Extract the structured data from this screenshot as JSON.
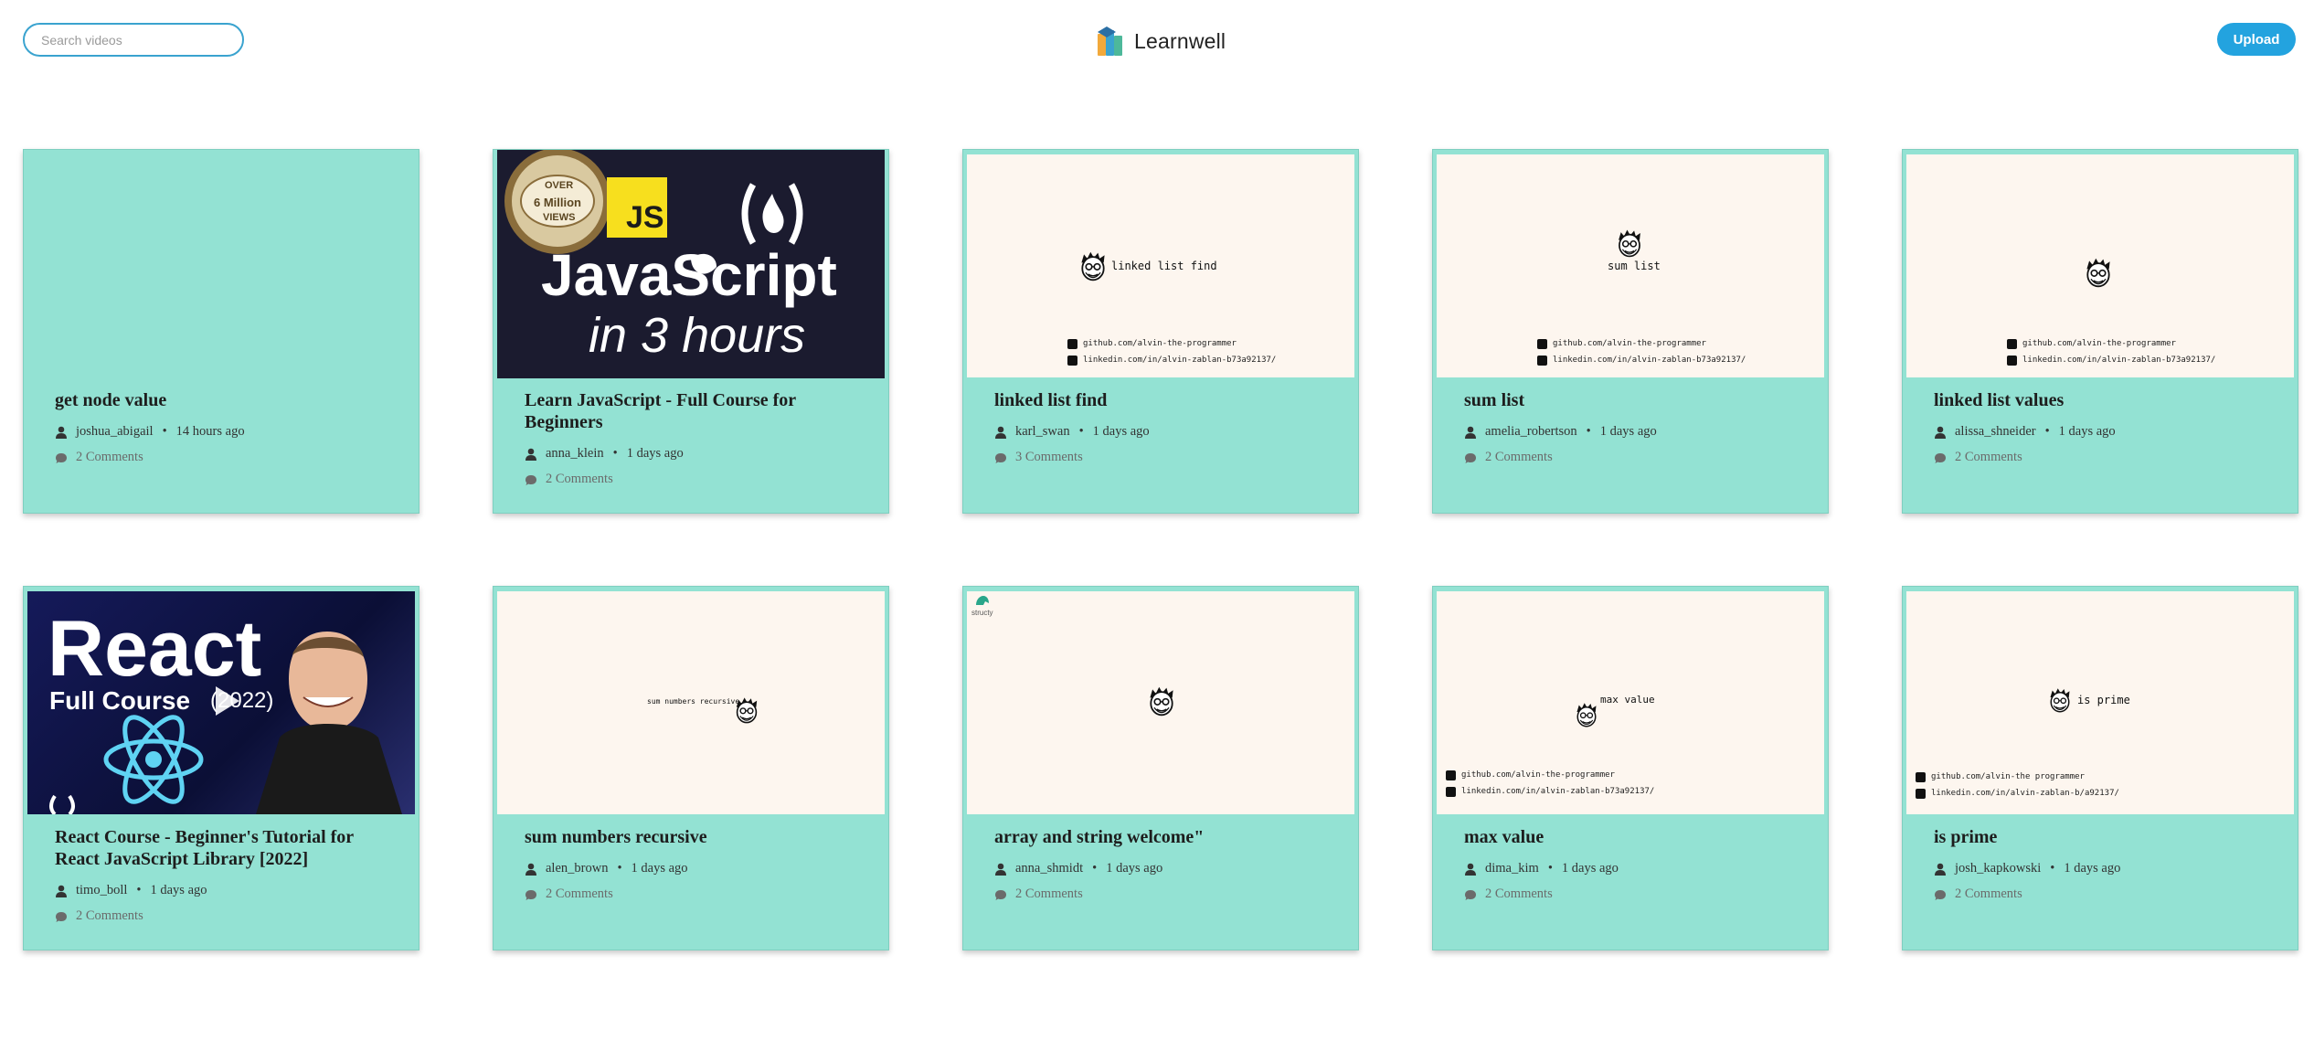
{
  "header": {
    "search_placeholder": "Search videos",
    "brand_name": "Learnwell",
    "upload_label": "Upload"
  },
  "videos": [
    {
      "title": "get node value",
      "author": "joshua_abigail",
      "time": "14 hours ago",
      "comments": "2 Comments"
    },
    {
      "title": "Learn JavaScript - Full Course for Beginners",
      "author": "anna_klein",
      "time": "1 days ago",
      "comments": "2 Comments",
      "thumb": {
        "badge_top": "OVER",
        "badge_mid": "6 Million",
        "badge_bot": "VIEWS",
        "js": "JS",
        "line1": "JavaScript",
        "line2": "in 3 hours"
      }
    },
    {
      "title": "linked list find",
      "author": "karl_swan",
      "time": "1 days ago",
      "comments": "3 Comments",
      "thumb": {
        "label": "linked list find",
        "link1": "github.com/alvin-the-programmer",
        "link2": "linkedin.com/in/alvin-zablan-b73a92137/"
      }
    },
    {
      "title": "sum list",
      "author": "amelia_robertson",
      "time": "1 days ago",
      "comments": "2 Comments",
      "thumb": {
        "label": "sum list",
        "link1": "github.com/alvin-the-programmer",
        "link2": "linkedin.com/in/alvin-zablan-b73a92137/"
      }
    },
    {
      "title": "linked list values",
      "author": "alissa_shneider",
      "time": "1 days ago",
      "comments": "2 Comments",
      "thumb": {
        "link1": "github.com/alvin-the-programmer",
        "link2": "linkedin.com/in/alvin-zablan-b73a92137/"
      }
    },
    {
      "title": "React Course - Beginner's Tutorial for React JavaScript Library [2022]",
      "author": "timo_boll",
      "time": "1 days ago",
      "comments": "2 Comments",
      "thumb": {
        "line1": "React",
        "line2": "Full Course",
        "year": "(2022)"
      }
    },
    {
      "title": "sum numbers recursive",
      "author": "alen_brown",
      "time": "1 days ago",
      "comments": "2 Comments",
      "thumb": {
        "label": "sum numbers recursive"
      }
    },
    {
      "title": "array and string welcome\"",
      "author": "anna_shmidt",
      "time": "1 days ago",
      "comments": "2 Comments",
      "thumb": {
        "brand": "structy"
      }
    },
    {
      "title": "max value",
      "author": "dima_kim",
      "time": "1 days ago",
      "comments": "2 Comments",
      "thumb": {
        "label": "max value",
        "link1": "github.com/alvin-the-programmer",
        "link2": "linkedin.com/in/alvin-zablan-b73a92137/"
      }
    },
    {
      "title": "is prime",
      "author": "josh_kapkowski",
      "time": "1 days ago",
      "comments": "2 Comments",
      "thumb": {
        "label": "is prime",
        "link1": "github.com/alvin-the programmer",
        "link2": "linkedin.com/in/alvin-zablan-b/a92137/"
      }
    }
  ]
}
